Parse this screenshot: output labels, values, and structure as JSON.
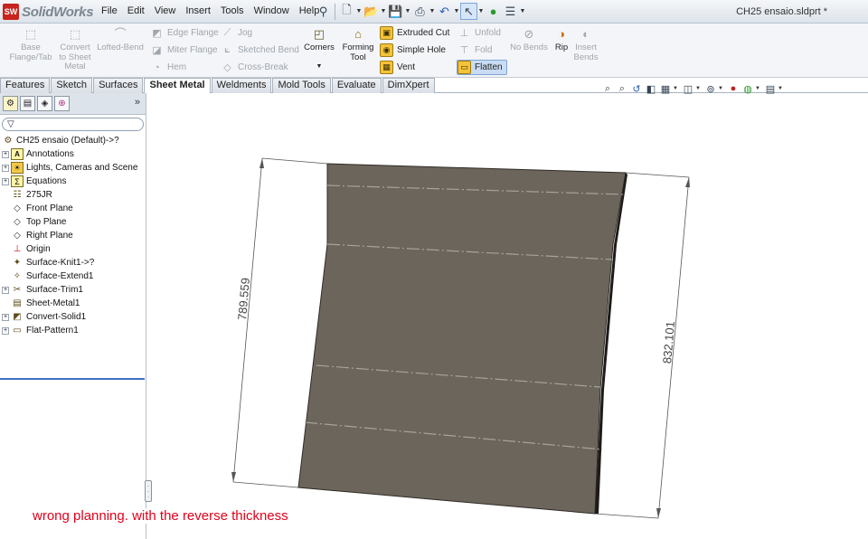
{
  "app": {
    "name": "SolidWorks",
    "logo_mark": "SW",
    "document_title": "CH25 ensaio.sldprt *"
  },
  "menu": [
    "File",
    "Edit",
    "View",
    "Insert",
    "Tools",
    "Window",
    "Help"
  ],
  "quick_access": [
    "new-icon",
    "open-icon",
    "save-icon",
    "print-icon",
    "undo-icon",
    "select-icon",
    "rebuild-icon",
    "options-icon"
  ],
  "ribbon": {
    "base_flange": "Base Flange/Tab",
    "convert": "Convert to Sheet Metal",
    "lofted_bend": "Lofted-Bend",
    "edge_flange": "Edge Flange",
    "miter_flange": "Miter Flange",
    "hem": "Hem",
    "jog": "Jog",
    "sketched_bend": "Sketched Bend",
    "cross_break": "Cross-Break",
    "corners": "Corners",
    "forming_tool": "Forming Tool",
    "extruded_cut": "Extruded Cut",
    "simple_hole": "Simple Hole",
    "vent": "Vent",
    "unfold": "Unfold",
    "fold": "Fold",
    "flatten": "Flatten",
    "no_bends": "No Bends",
    "rip": "Rip",
    "insert_bends": "Insert Bends"
  },
  "command_tabs": [
    {
      "label": "Features",
      "active": false
    },
    {
      "label": "Sketch",
      "active": false
    },
    {
      "label": "Surfaces",
      "active": false
    },
    {
      "label": "Sheet Metal",
      "active": true
    },
    {
      "label": "Weldments",
      "active": false
    },
    {
      "label": "Mold Tools",
      "active": false
    },
    {
      "label": "Evaluate",
      "active": false
    },
    {
      "label": "DimXpert",
      "active": false
    }
  ],
  "feature_tree": {
    "root": "CH25 ensaio  (Default)->?",
    "items": [
      {
        "label": "Annotations",
        "icon": "annotations-icon",
        "expandable": true
      },
      {
        "label": "Lights, Cameras and Scene",
        "icon": "lights-icon",
        "expandable": true
      },
      {
        "label": "Equations",
        "icon": "equations-icon",
        "expandable": true
      },
      {
        "label": "275JR",
        "icon": "material-icon",
        "expandable": false
      },
      {
        "label": "Front Plane",
        "icon": "plane-icon",
        "expandable": false
      },
      {
        "label": "Top Plane",
        "icon": "plane-icon",
        "expandable": false
      },
      {
        "label": "Right Plane",
        "icon": "plane-icon",
        "expandable": false
      },
      {
        "label": "Origin",
        "icon": "origin-icon",
        "expandable": false
      },
      {
        "label": "Surface-Knit1->?",
        "icon": "surface-knit-icon",
        "expandable": false
      },
      {
        "label": "Surface-Extend1",
        "icon": "surface-extend-icon",
        "expandable": false
      },
      {
        "label": "Surface-Trim1",
        "icon": "surface-trim-icon",
        "expandable": true
      },
      {
        "label": "Sheet-Metal1",
        "icon": "sheet-metal-icon",
        "expandable": false
      },
      {
        "label": "Convert-Solid1",
        "icon": "convert-solid-icon",
        "expandable": true
      },
      {
        "label": "Flat-Pattern1",
        "icon": "flat-pattern-icon",
        "expandable": true
      }
    ]
  },
  "viewport": {
    "dimension_left": "789.559",
    "dimension_right": "832.101",
    "part_color": "#6b655b",
    "annotation_text": "wrong planning. with the reverse thickness",
    "annotation_color": "#e2001a"
  }
}
